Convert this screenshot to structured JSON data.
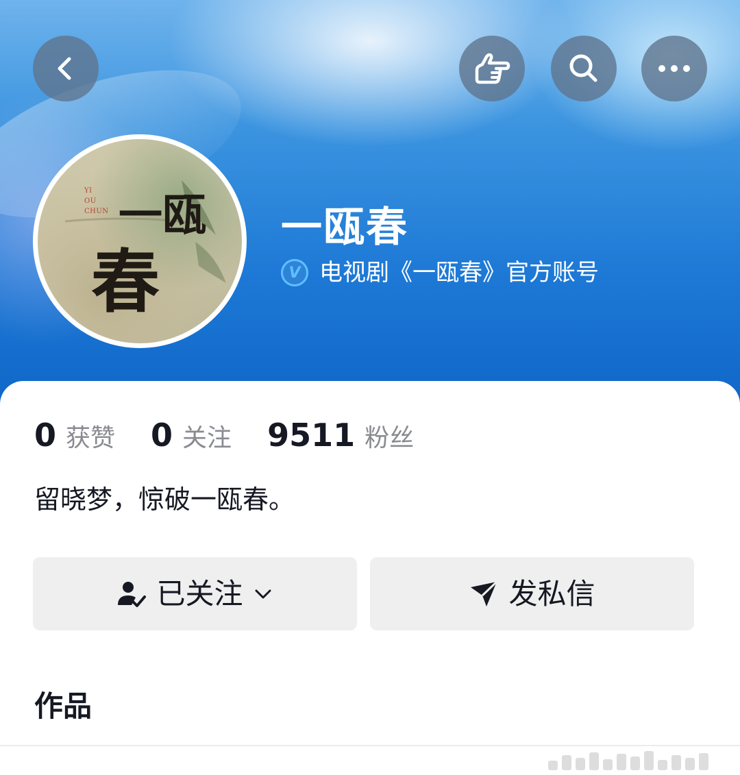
{
  "profile": {
    "name": "一瓯春",
    "verified": true,
    "verification_text": "电视剧《一瓯春》官方账号",
    "bio": "留晓梦，惊破一瓯春。",
    "avatar_text": {
      "main_top": "一瓯",
      "main_bottom": "春",
      "small": [
        "YI",
        "OU",
        "CHUN"
      ]
    }
  },
  "stats": [
    {
      "value": "0",
      "label": "获赞"
    },
    {
      "value": "0",
      "label": "关注"
    },
    {
      "value": "9511",
      "label": "粉丝"
    }
  ],
  "actions": {
    "follow_label": "已关注",
    "message_label": "发私信"
  },
  "tabs": {
    "works_label": "作品"
  },
  "icons": {
    "back": "chevron-left-icon",
    "share": "pointing-hand-icon",
    "search": "search-icon",
    "more": "more-dots-icon",
    "verify": "verified-v-icon",
    "followed": "user-check-icon",
    "dropdown": "chevron-down-icon",
    "message": "paper-plane-icon"
  },
  "colors": {
    "header_blue": "#1e7ad6",
    "verify_blue": "#5fc0ff",
    "text_primary": "#161823",
    "text_secondary": "#8a8b91",
    "button_bg": "#efefef"
  }
}
